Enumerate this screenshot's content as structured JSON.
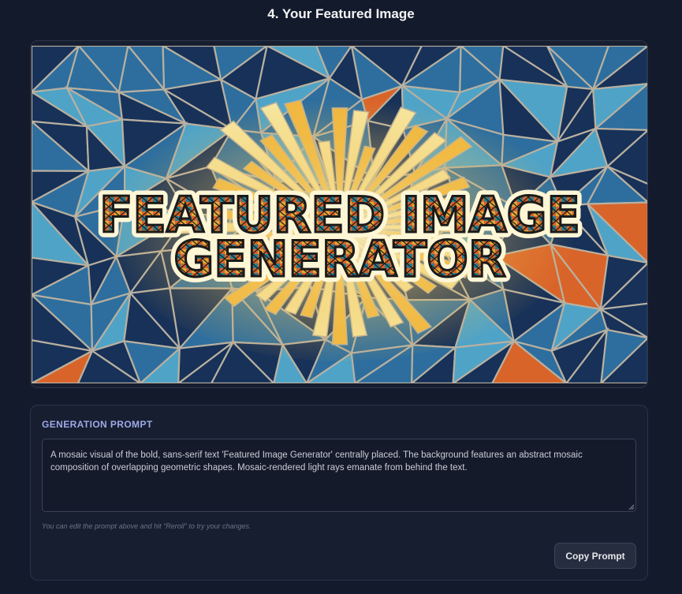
{
  "section": {
    "title": "4. Your Featured Image"
  },
  "featured_image": {
    "headline_line1": "FEATURED IMAGE",
    "headline_line2": "GENERATOR",
    "colors": {
      "background": "#1b3d6b",
      "tile_dark": "#173158",
      "tile_mid": "#2d6e9e",
      "tile_light": "#4fa3c7",
      "grout": "#b8b0a0",
      "ray_gold": "#f0b840",
      "ray_pale": "#f6e6a0",
      "accent_orange": "#d9642a",
      "letter_outline": "#1a1a1a"
    }
  },
  "prompt_panel": {
    "label": "GENERATION PROMPT",
    "prompt_text": "A mosaic visual of the bold, sans-serif text 'Featured Image Generator' centrally placed. The background features an abstract mosaic composition of overlapping geometric shapes. Mosaic-rendered light rays emanate from behind the text.",
    "hint": "You can edit the prompt above and hit \"Reroll\" to try your changes.",
    "copy_button_label": "Copy Prompt"
  }
}
